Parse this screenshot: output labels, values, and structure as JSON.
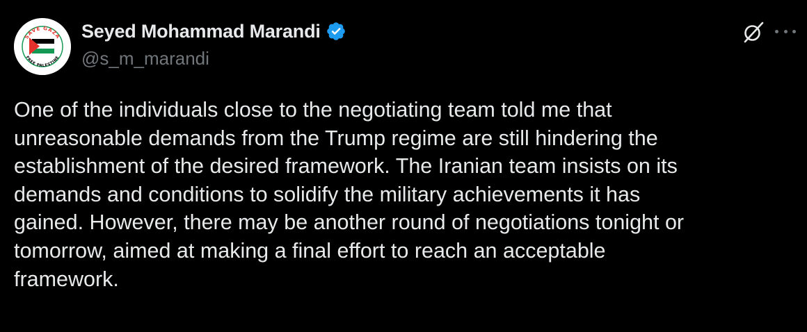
{
  "author": {
    "display_name": "Seyed Mohammad Marandi",
    "handle": "@s_m_marandi",
    "verified": true,
    "verified_color": "#1d9bf0",
    "avatar_icon": "save-gaza-palestine-flag-logo",
    "avatar_text_top": "SAVE GAZA",
    "avatar_text_bottom": "FREE PALESTINE"
  },
  "actions": {
    "grok_icon": "grok-icon",
    "more_icon": "more-options-icon"
  },
  "post": {
    "lines": [
      "One of the individuals close to the negotiating team told me that",
      "unreasonable demands from the Trump regime are still hindering the",
      "establishment of the desired framework. The Iranian team insists on its",
      "demands and conditions to solidify the military achievements it has",
      "gained. However, there may be another round of negotiations tonight or",
      "tomorrow, aimed at making a final effort to reach an acceptable",
      "framework."
    ]
  },
  "colors": {
    "background": "#000000",
    "text_primary": "#e7e9ea",
    "text_secondary": "#71767b",
    "flag_red": "#e4312b",
    "flag_green": "#149954",
    "flag_black": "#000000"
  }
}
